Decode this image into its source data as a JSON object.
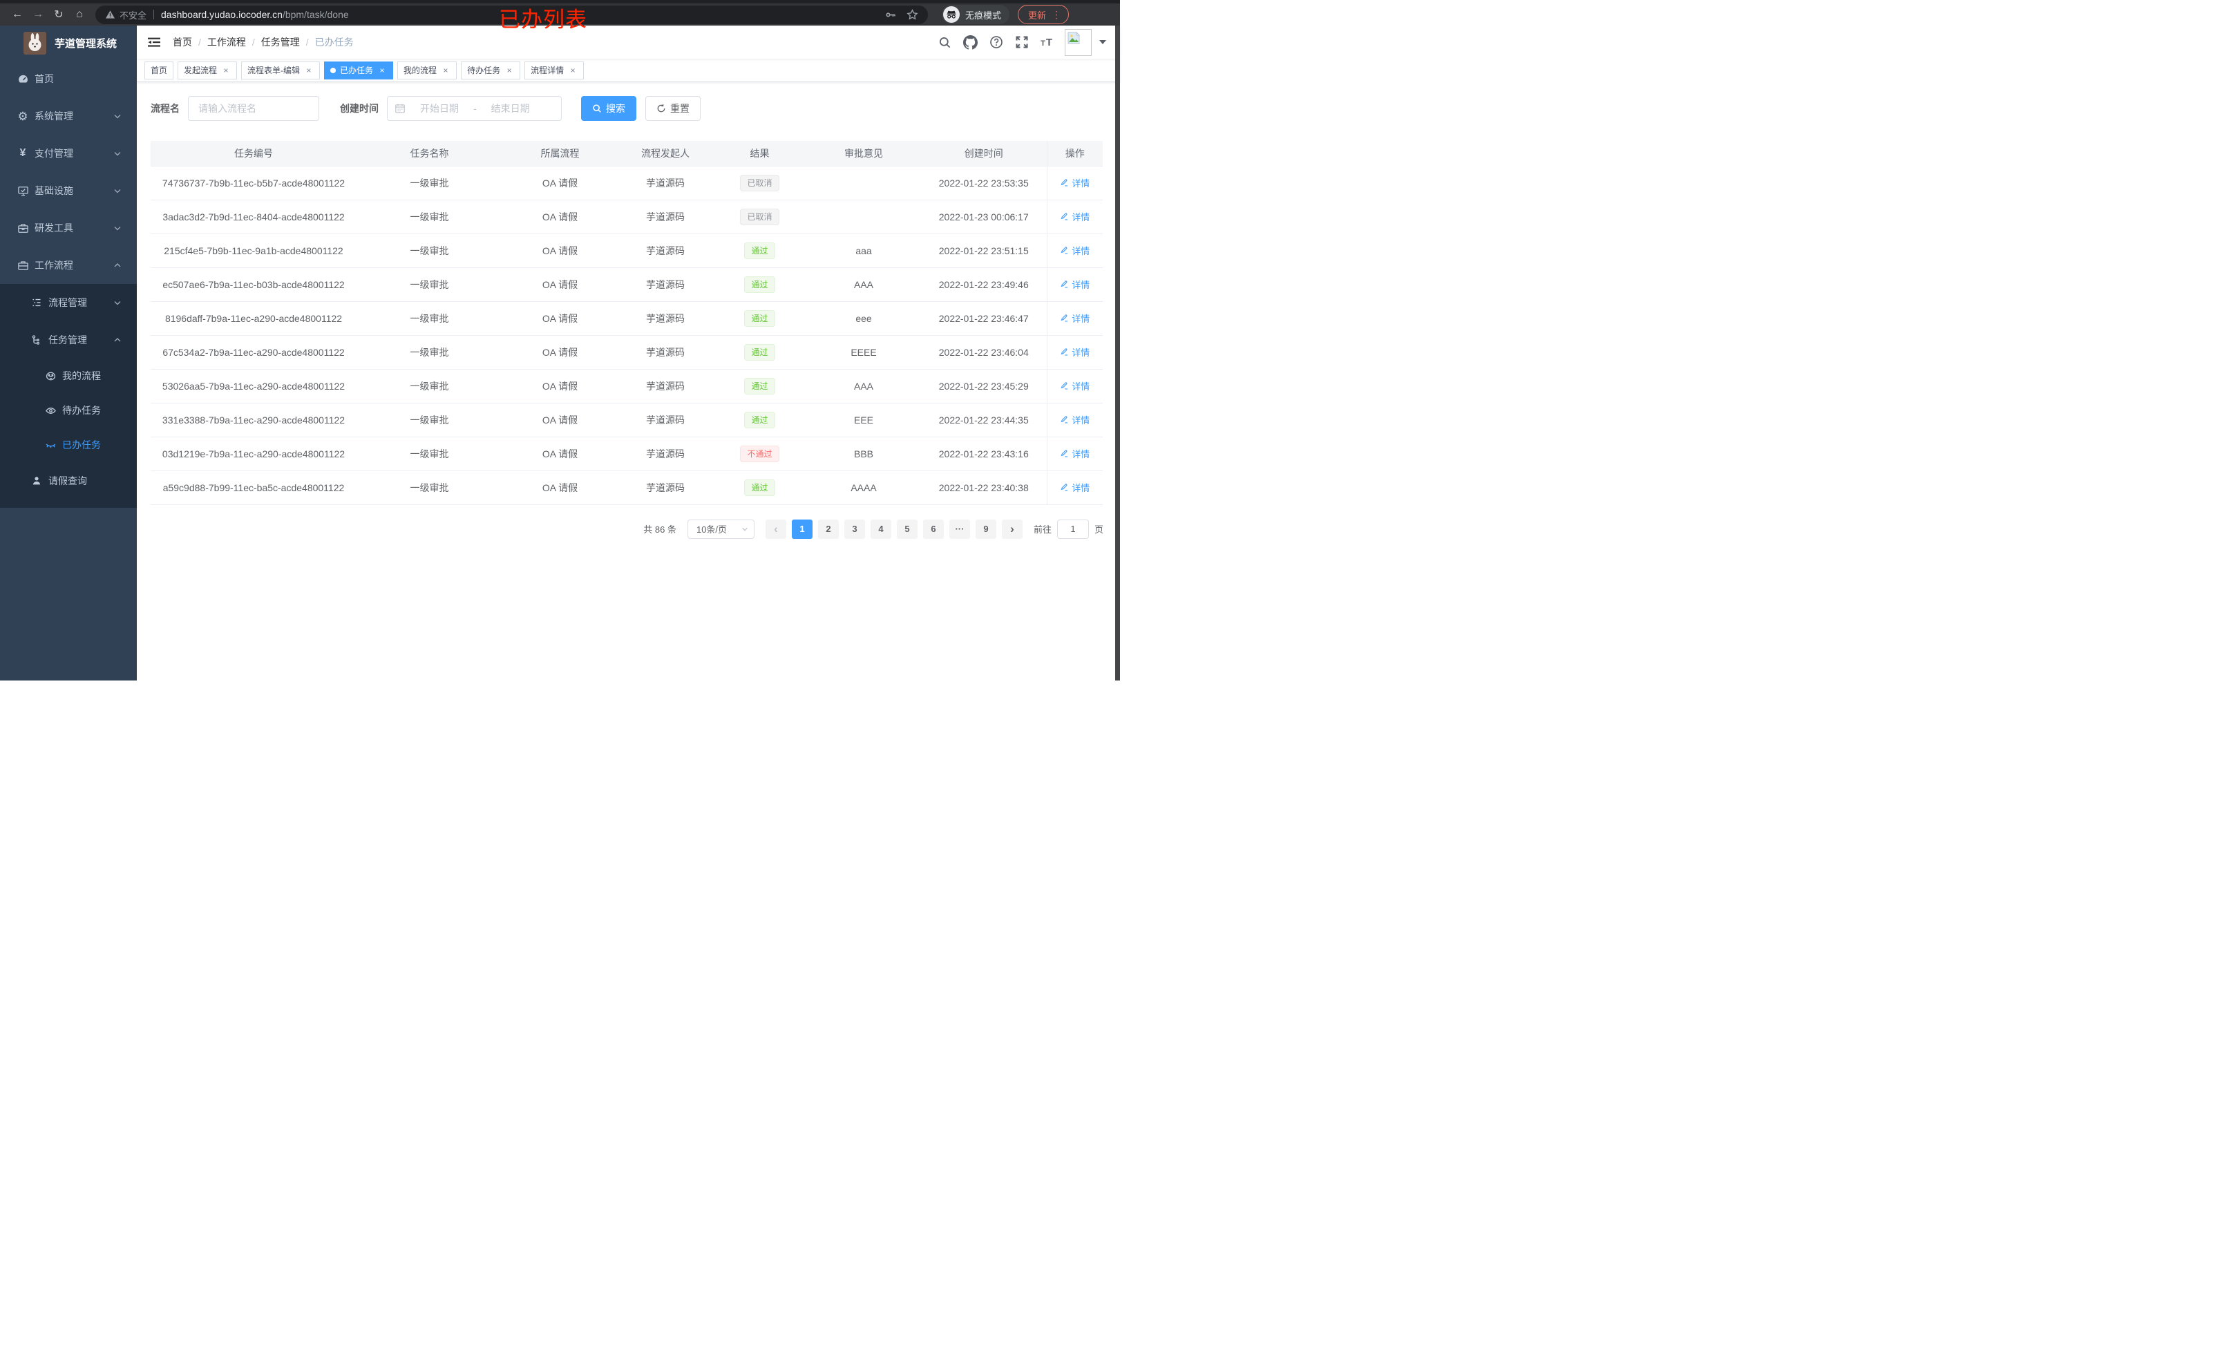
{
  "annotation": {
    "text": "已办列表"
  },
  "browser": {
    "security_label": "不安全",
    "url_host": "dashboard.yudao.iocoder.cn",
    "url_path": "/bpm/task/done",
    "incognito_label": "无痕模式",
    "update_label": "更新"
  },
  "sidebar": {
    "app_title": "芋道管理系统",
    "menu": [
      {
        "label": "首页",
        "icon": "dashboard-icon"
      },
      {
        "label": "系统管理",
        "icon": "gear-icon"
      },
      {
        "label": "支付管理",
        "icon": "yen-icon"
      },
      {
        "label": "基础设施",
        "icon": "monitor-icon"
      },
      {
        "label": "研发工具",
        "icon": "toolbox-icon"
      },
      {
        "label": "工作流程",
        "icon": "briefcase-icon"
      }
    ],
    "submenu": [
      {
        "label": "流程管理",
        "icon": "tree-list-icon"
      },
      {
        "label": "任务管理",
        "icon": "flow-icon"
      },
      {
        "label": "我的流程",
        "icon": "face-icon"
      },
      {
        "label": "待办任务",
        "icon": "eye-icon"
      },
      {
        "label": "已办任务",
        "icon": "eye-closed-icon",
        "active": true
      },
      {
        "label": "请假查询",
        "icon": "person-icon"
      }
    ]
  },
  "breadcrumb": {
    "items": [
      "首页",
      "工作流程",
      "任务管理",
      "已办任务"
    ]
  },
  "tags": {
    "items": [
      "首页",
      "发起流程",
      "流程表单-编辑",
      "已办任务",
      "我的流程",
      "待办任务",
      "流程详情"
    ],
    "active": "已办任务"
  },
  "filters": {
    "name_label": "流程名",
    "name_placeholder": "请输入流程名",
    "time_label": "创建时间",
    "start_placeholder": "开始日期",
    "range_separator": "-",
    "end_placeholder": "结束日期",
    "search_label": "搜索",
    "reset_label": "重置"
  },
  "table": {
    "headers": [
      "任务编号",
      "任务名称",
      "所属流程",
      "流程发起人",
      "结果",
      "审批意见",
      "创建时间",
      "操作"
    ],
    "action_label": "详情",
    "rows": [
      {
        "id": "74736737-7b9b-11ec-b5b7-acde48001122",
        "name": "一级审批",
        "process": "OA 请假",
        "starter": "芋道源码",
        "result": "已取消",
        "result_type": "info",
        "opinion": "",
        "created": "2022-01-22 23:53:35"
      },
      {
        "id": "3adac3d2-7b9d-11ec-8404-acde48001122",
        "name": "一级审批",
        "process": "OA 请假",
        "starter": "芋道源码",
        "result": "已取消",
        "result_type": "info",
        "opinion": "",
        "created": "2022-01-23 00:06:17"
      },
      {
        "id": "215cf4e5-7b9b-11ec-9a1b-acde48001122",
        "name": "一级审批",
        "process": "OA 请假",
        "starter": "芋道源码",
        "result": "通过",
        "result_type": "success",
        "opinion": "aaa",
        "created": "2022-01-22 23:51:15"
      },
      {
        "id": "ec507ae6-7b9a-11ec-b03b-acde48001122",
        "name": "一级审批",
        "process": "OA 请假",
        "starter": "芋道源码",
        "result": "通过",
        "result_type": "success",
        "opinion": "AAA",
        "created": "2022-01-22 23:49:46"
      },
      {
        "id": "8196daff-7b9a-11ec-a290-acde48001122",
        "name": "一级审批",
        "process": "OA 请假",
        "starter": "芋道源码",
        "result": "通过",
        "result_type": "success",
        "opinion": "eee",
        "created": "2022-01-22 23:46:47"
      },
      {
        "id": "67c534a2-7b9a-11ec-a290-acde48001122",
        "name": "一级审批",
        "process": "OA 请假",
        "starter": "芋道源码",
        "result": "通过",
        "result_type": "success",
        "opinion": "EEEE",
        "created": "2022-01-22 23:46:04"
      },
      {
        "id": "53026aa5-7b9a-11ec-a290-acde48001122",
        "name": "一级审批",
        "process": "OA 请假",
        "starter": "芋道源码",
        "result": "通过",
        "result_type": "success",
        "opinion": "AAA",
        "created": "2022-01-22 23:45:29"
      },
      {
        "id": "331e3388-7b9a-11ec-a290-acde48001122",
        "name": "一级审批",
        "process": "OA 请假",
        "starter": "芋道源码",
        "result": "通过",
        "result_type": "success",
        "opinion": "EEE",
        "created": "2022-01-22 23:44:35"
      },
      {
        "id": "03d1219e-7b9a-11ec-a290-acde48001122",
        "name": "一级审批",
        "process": "OA 请假",
        "starter": "芋道源码",
        "result": "不通过",
        "result_type": "danger",
        "opinion": "BBB",
        "created": "2022-01-22 23:43:16"
      },
      {
        "id": "a59c9d88-7b99-11ec-ba5c-acde48001122",
        "name": "一级审批",
        "process": "OA 请假",
        "starter": "芋道源码",
        "result": "通过",
        "result_type": "success",
        "opinion": "AAAA",
        "created": "2022-01-22 23:40:38"
      }
    ]
  },
  "pagination": {
    "total": "共 86 条",
    "page_size": "10条/页",
    "prev": "‹",
    "pages": [
      "1",
      "2",
      "3",
      "4",
      "5",
      "6",
      "···",
      "9"
    ],
    "active_page": "1",
    "next": "›",
    "jump_prefix": "前往",
    "jump_value": "1",
    "jump_suffix": "页"
  },
  "colors": {
    "accent": "#409eff",
    "sidebar_bg": "#304156",
    "submenu_bg": "#1f2d3d",
    "success": "#67c23a",
    "danger": "#f56c6c",
    "info": "#909399",
    "update_red": "#e8756a"
  }
}
